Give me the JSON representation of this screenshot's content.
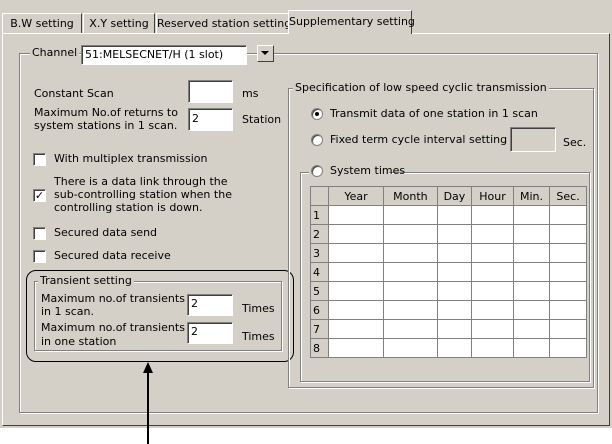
{
  "tabs": [
    {
      "label": "B.W setting"
    },
    {
      "label": "X.Y setting"
    },
    {
      "label": "Reserved station setting"
    },
    {
      "label": "Supplementary setting"
    }
  ],
  "channel": {
    "label": "Channel",
    "value": "51:MELSECNET/H (1 slot)"
  },
  "constant_scan": {
    "label": "Constant Scan",
    "value": "",
    "unit": "ms"
  },
  "max_returns": {
    "label_line1": "Maximum No.of returns to",
    "label_line2": "system stations in 1 scan.",
    "value": "2",
    "unit": "Station"
  },
  "checkboxes": [
    {
      "label": "With multiplex transmission",
      "checked": false
    },
    {
      "label_line1": "There is a data link through the",
      "label_line2": "sub-controlling station when the",
      "label_line3": "controlling station is down.",
      "checked": true
    },
    {
      "label": "Secured data send",
      "checked": false
    },
    {
      "label": "Secured data receive",
      "checked": false
    }
  ],
  "transient": {
    "title": "Transient setting",
    "per_scan": {
      "label_line1": "Maximum no.of transients",
      "label_line2": "in 1 scan.",
      "value": "2",
      "unit": "Times"
    },
    "per_station": {
      "label_line1": "Maximum no.of transients",
      "label_line2": "in one station",
      "value": "2",
      "unit": "Times"
    }
  },
  "low_speed": {
    "title": "Specification of low speed cyclic transmission",
    "options": [
      {
        "label": "Transmit data of one station in 1 scan",
        "selected": true
      },
      {
        "label": "Fixed term cycle interval setting",
        "selected": false
      },
      {
        "label": "System times",
        "selected": false
      }
    ],
    "interval_value": "",
    "interval_unit": "Sec.",
    "columns": [
      "Year",
      "Month",
      "Day",
      "Hour",
      "Min.",
      "Sec."
    ],
    "rows": [
      "1",
      "2",
      "3",
      "4",
      "5",
      "6",
      "7",
      "8"
    ]
  },
  "colors": {
    "window": "#d4d0c8",
    "shadow": "#808080",
    "highlight": "#ffffff"
  }
}
